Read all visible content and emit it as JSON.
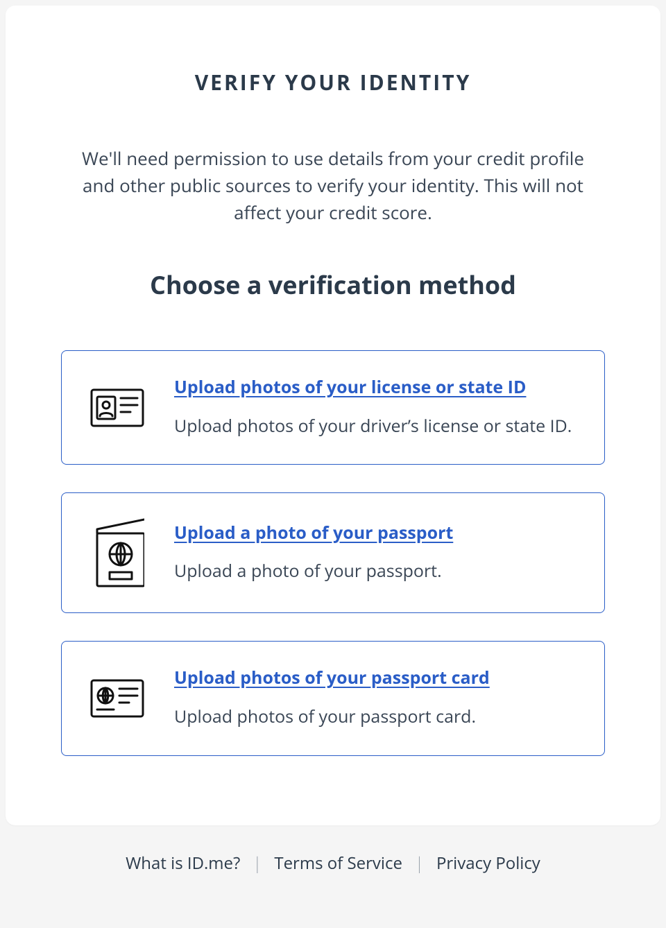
{
  "page_title": "VERIFY YOUR IDENTITY",
  "intro": "We'll need permission to use details from your credit profile and other public sources to verify your identity. This will not affect your credit score.",
  "subtitle": "Choose a verification method",
  "options": [
    {
      "title": "Upload photos of your license or state ID",
      "desc": "Upload photos of your driver’s license or state ID."
    },
    {
      "title": "Upload a photo of your passport",
      "desc": "Upload a photo of your passport."
    },
    {
      "title": "Upload photos of your passport card",
      "desc": "Upload photos of your passport card."
    }
  ],
  "footer": {
    "what_is": "What is ID.me?",
    "terms": "Terms of Service",
    "privacy": "Privacy Policy"
  }
}
